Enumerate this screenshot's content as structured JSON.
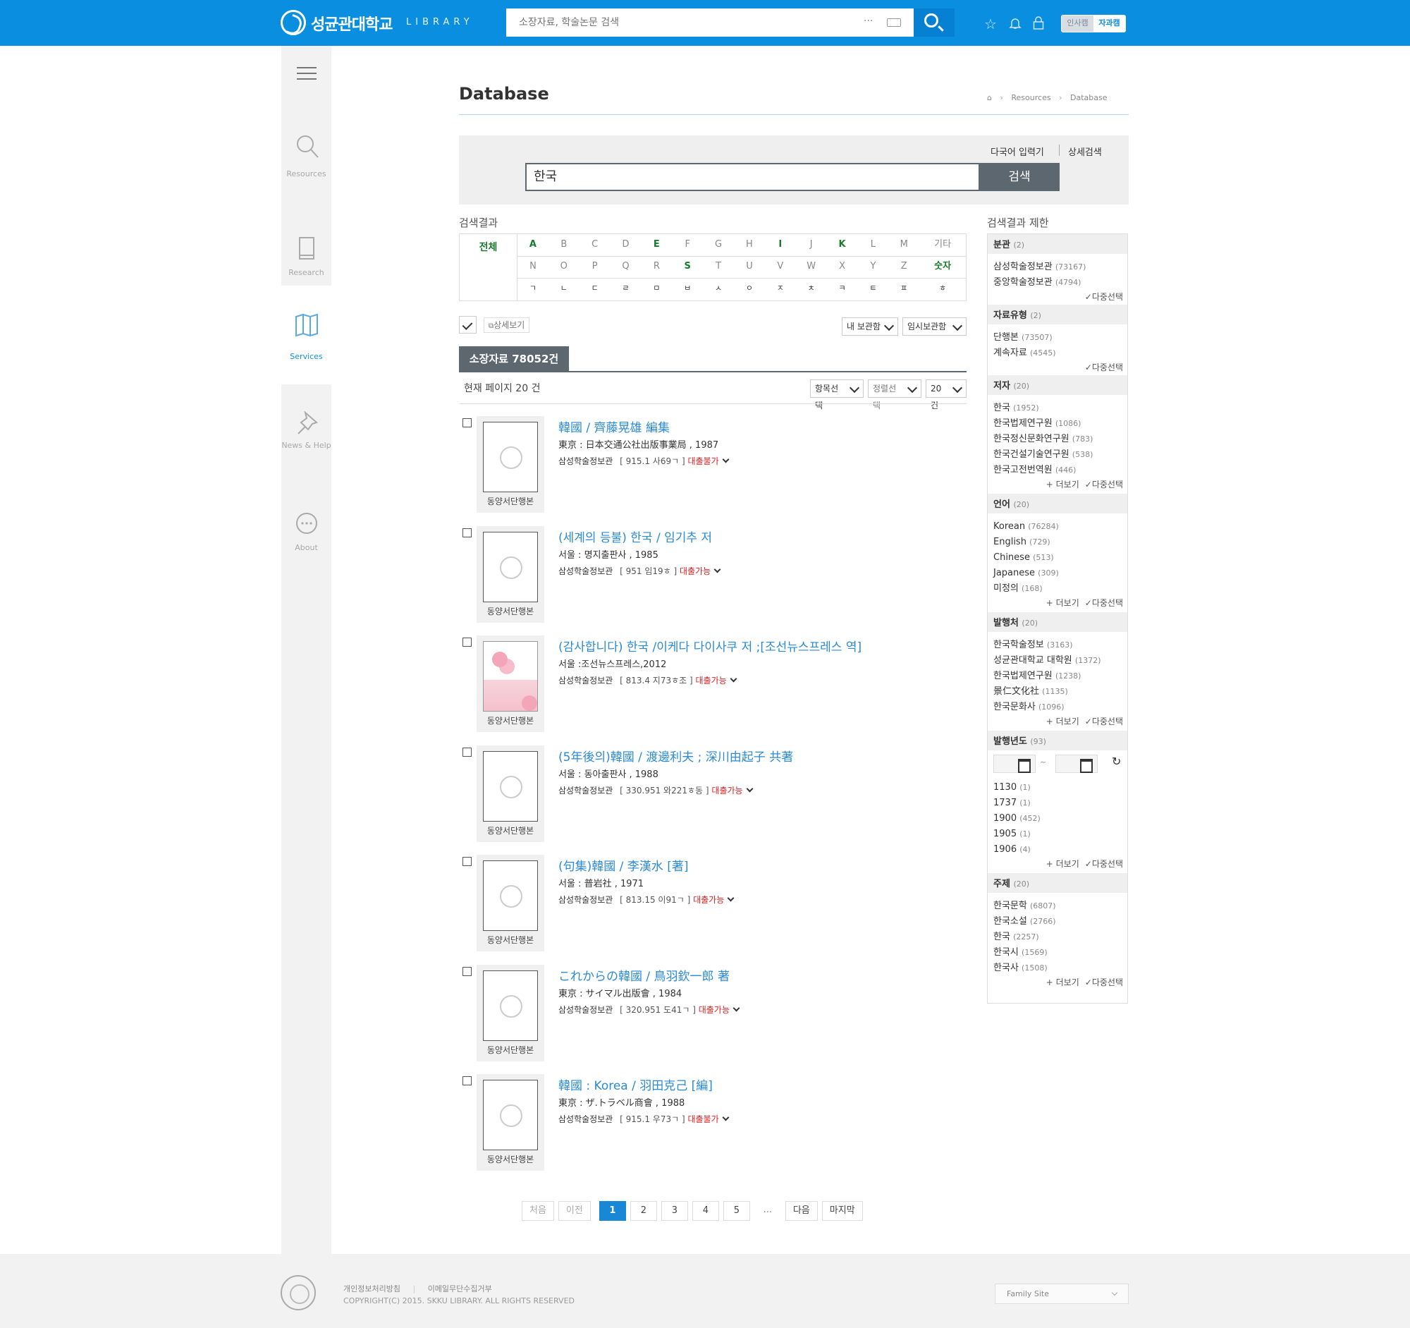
{
  "header": {
    "logo_text": "성균관대학교",
    "logo_sub": "LIBRARY",
    "search_placeholder": "소장자료, 학술논문 검색",
    "search_dots": "···",
    "campus_humanities": "인사캠",
    "campus_science": "자과캠"
  },
  "sidebar": {
    "items": [
      {
        "label": "Resources",
        "icon": "search-icon"
      },
      {
        "label": "Research",
        "icon": "book-icon"
      },
      {
        "label": "Services",
        "icon": "map-icon"
      },
      {
        "label": "News & Help",
        "icon": "pin-icon"
      },
      {
        "label": "About",
        "icon": "more-icon"
      }
    ]
  },
  "page": {
    "title": "Database",
    "breadcrumb": [
      "Resources",
      "Database"
    ]
  },
  "search": {
    "multi_lang": "다국어 입력기",
    "advanced": "상세검색",
    "query": "한국",
    "button": "검색"
  },
  "results": {
    "label": "검색결과",
    "all": "전체",
    "alpha_row1": [
      "A",
      "B",
      "C",
      "D",
      "E",
      "F",
      "G",
      "H",
      "I",
      "J",
      "K",
      "L",
      "M",
      "기타"
    ],
    "alpha_row2": [
      "N",
      "O",
      "P",
      "Q",
      "R",
      "S",
      "T",
      "U",
      "V",
      "W",
      "X",
      "Y",
      "Z",
      "숫자"
    ],
    "alpha_row3": [
      "ㄱ",
      "ㄴ",
      "ㄷ",
      "ㄹ",
      "ㅁ",
      "ㅂ",
      "ㅅ",
      "ㅇ",
      "ㅈ",
      "ㅊ",
      "ㅋ",
      "ㅌ",
      "ㅍ",
      "ㅎ"
    ],
    "detail_view": "상세보기",
    "my_library": "내 보관함",
    "temp_library": "임시보관함",
    "tab_label": "소장자료 78052건",
    "page_count": "현재 페이지 20 건",
    "field_select": "항목선택",
    "sort_select": "정렬선택",
    "per_page": "20건"
  },
  "items": [
    {
      "title": "韓國 / 齊藤晃雄 編集",
      "pub": "東京 : 日本交通公社出版事業局 , 1987",
      "library": "삼성학술정보관",
      "call": "[ 915.1 사69ㄱ ]",
      "status": "대출불가",
      "type": "동양서단행본"
    },
    {
      "title": "(세계의 등불) 한국 / 임기추 저",
      "pub": "서울 : 명지출판사 , 1985",
      "library": "삼성학술정보관",
      "call": "[ 951 임19ㅎ ]",
      "status": "대출가능",
      "type": "동양서단행본"
    },
    {
      "title": "(감사합니다) 한국 /이케다 다이사쿠 저 ;[조선뉴스프레스 역]",
      "pub": "서울 :조선뉴스프레스,2012",
      "library": "삼성학술정보관",
      "call": "[ 813.4 지73ㅎ조 ]",
      "status": "대출가능",
      "type": "동양서단행본"
    },
    {
      "title": "(5年後의)韓國 / 渡邊利夫 ; 深川由起子 共著",
      "pub": "서울 : 동아출판사 , 1988",
      "library": "삼성학술정보관",
      "call": "[ 330.951 와221ㅎ동 ]",
      "status": "대출가능",
      "type": "동양서단행본"
    },
    {
      "title": "(句集)韓國 / 李漢水 [著]",
      "pub": "서울 : 普岩社 , 1971",
      "library": "삼성학술정보관",
      "call": "[ 813.15 이91ㄱ ]",
      "status": "대출가능",
      "type": "동양서단행본"
    },
    {
      "title": "これからの韓國 / 鳥羽欽一郎 著",
      "pub": "東京 : サイマル出版會 , 1984",
      "library": "삼성학술정보관",
      "call": "[ 320.951 도41ㄱ ]",
      "status": "대출가능",
      "type": "동양서단행본"
    },
    {
      "title": "韓國 : Korea / 羽田克己 [編]",
      "pub": "東京 : ザ.トラベル商會 , 1988",
      "library": "삼성학술정보관",
      "call": "[ 915.1 우73ㄱ ]",
      "status": "대출불가",
      "type": "동양서단행본"
    }
  ],
  "pager": {
    "first": "처음",
    "prev": "이전",
    "pages": [
      "1",
      "2",
      "3",
      "4",
      "5"
    ],
    "dots": "...",
    "next": "다음",
    "last": "마지막"
  },
  "facets": {
    "label": "검색결과 제한",
    "more": "더보기",
    "multi": "다중선택",
    "year_tilde": "~",
    "sections": [
      {
        "name": "분관",
        "count": "(2)",
        "items": [
          [
            "삼성학술정보관",
            "(73167)"
          ],
          [
            "중앙학술정보관",
            "(4794)"
          ]
        ]
      },
      {
        "name": "자료유형",
        "count": "(2)",
        "items": [
          [
            "단행본",
            "(73507)"
          ],
          [
            "계속자료",
            "(4545)"
          ]
        ]
      },
      {
        "name": "저자",
        "count": "(20)",
        "items": [
          [
            "한국",
            "(1952)"
          ],
          [
            "한국법제연구원",
            "(1086)"
          ],
          [
            "한국정신문화연구원",
            "(783)"
          ],
          [
            "한국건설기술연구원",
            "(538)"
          ],
          [
            "한국고전번역원",
            "(446)"
          ]
        ]
      },
      {
        "name": "언어",
        "count": "(20)",
        "items": [
          [
            "Korean",
            "(76284)"
          ],
          [
            "English",
            "(729)"
          ],
          [
            "Chinese",
            "(513)"
          ],
          [
            "Japanese",
            "(309)"
          ],
          [
            "미정의",
            "(168)"
          ]
        ]
      },
      {
        "name": "발행처",
        "count": "(20)",
        "items": [
          [
            "한국학술정보",
            "(3163)"
          ],
          [
            "성균관대학교 대학원",
            "(1372)"
          ],
          [
            "한국법제연구원",
            "(1238)"
          ],
          [
            "景仁文化社",
            "(1135)"
          ],
          [
            "한국문화사",
            "(1096)"
          ]
        ]
      },
      {
        "name": "발행년도",
        "count": "(93)",
        "items": [
          [
            "1130",
            "(1)"
          ],
          [
            "1737",
            "(1)"
          ],
          [
            "1900",
            "(452)"
          ],
          [
            "1905",
            "(1)"
          ],
          [
            "1906",
            "(4)"
          ]
        ]
      },
      {
        "name": "주제",
        "count": "(20)",
        "items": [
          [
            "한국문학",
            "(6807)"
          ],
          [
            "한국소설",
            "(2766)"
          ],
          [
            "한국",
            "(2257)"
          ],
          [
            "한국시",
            "(1569)"
          ],
          [
            "한국사",
            "(1508)"
          ]
        ]
      }
    ]
  },
  "footer": {
    "privacy": "개인정보처리방침",
    "email_refuse": "이메일무단수집거부",
    "copyright": "COPYRIGHT(C) 2015. SKKU LIBRARY. ALL RIGHTS RESERVED",
    "family_site": "Family Site"
  }
}
